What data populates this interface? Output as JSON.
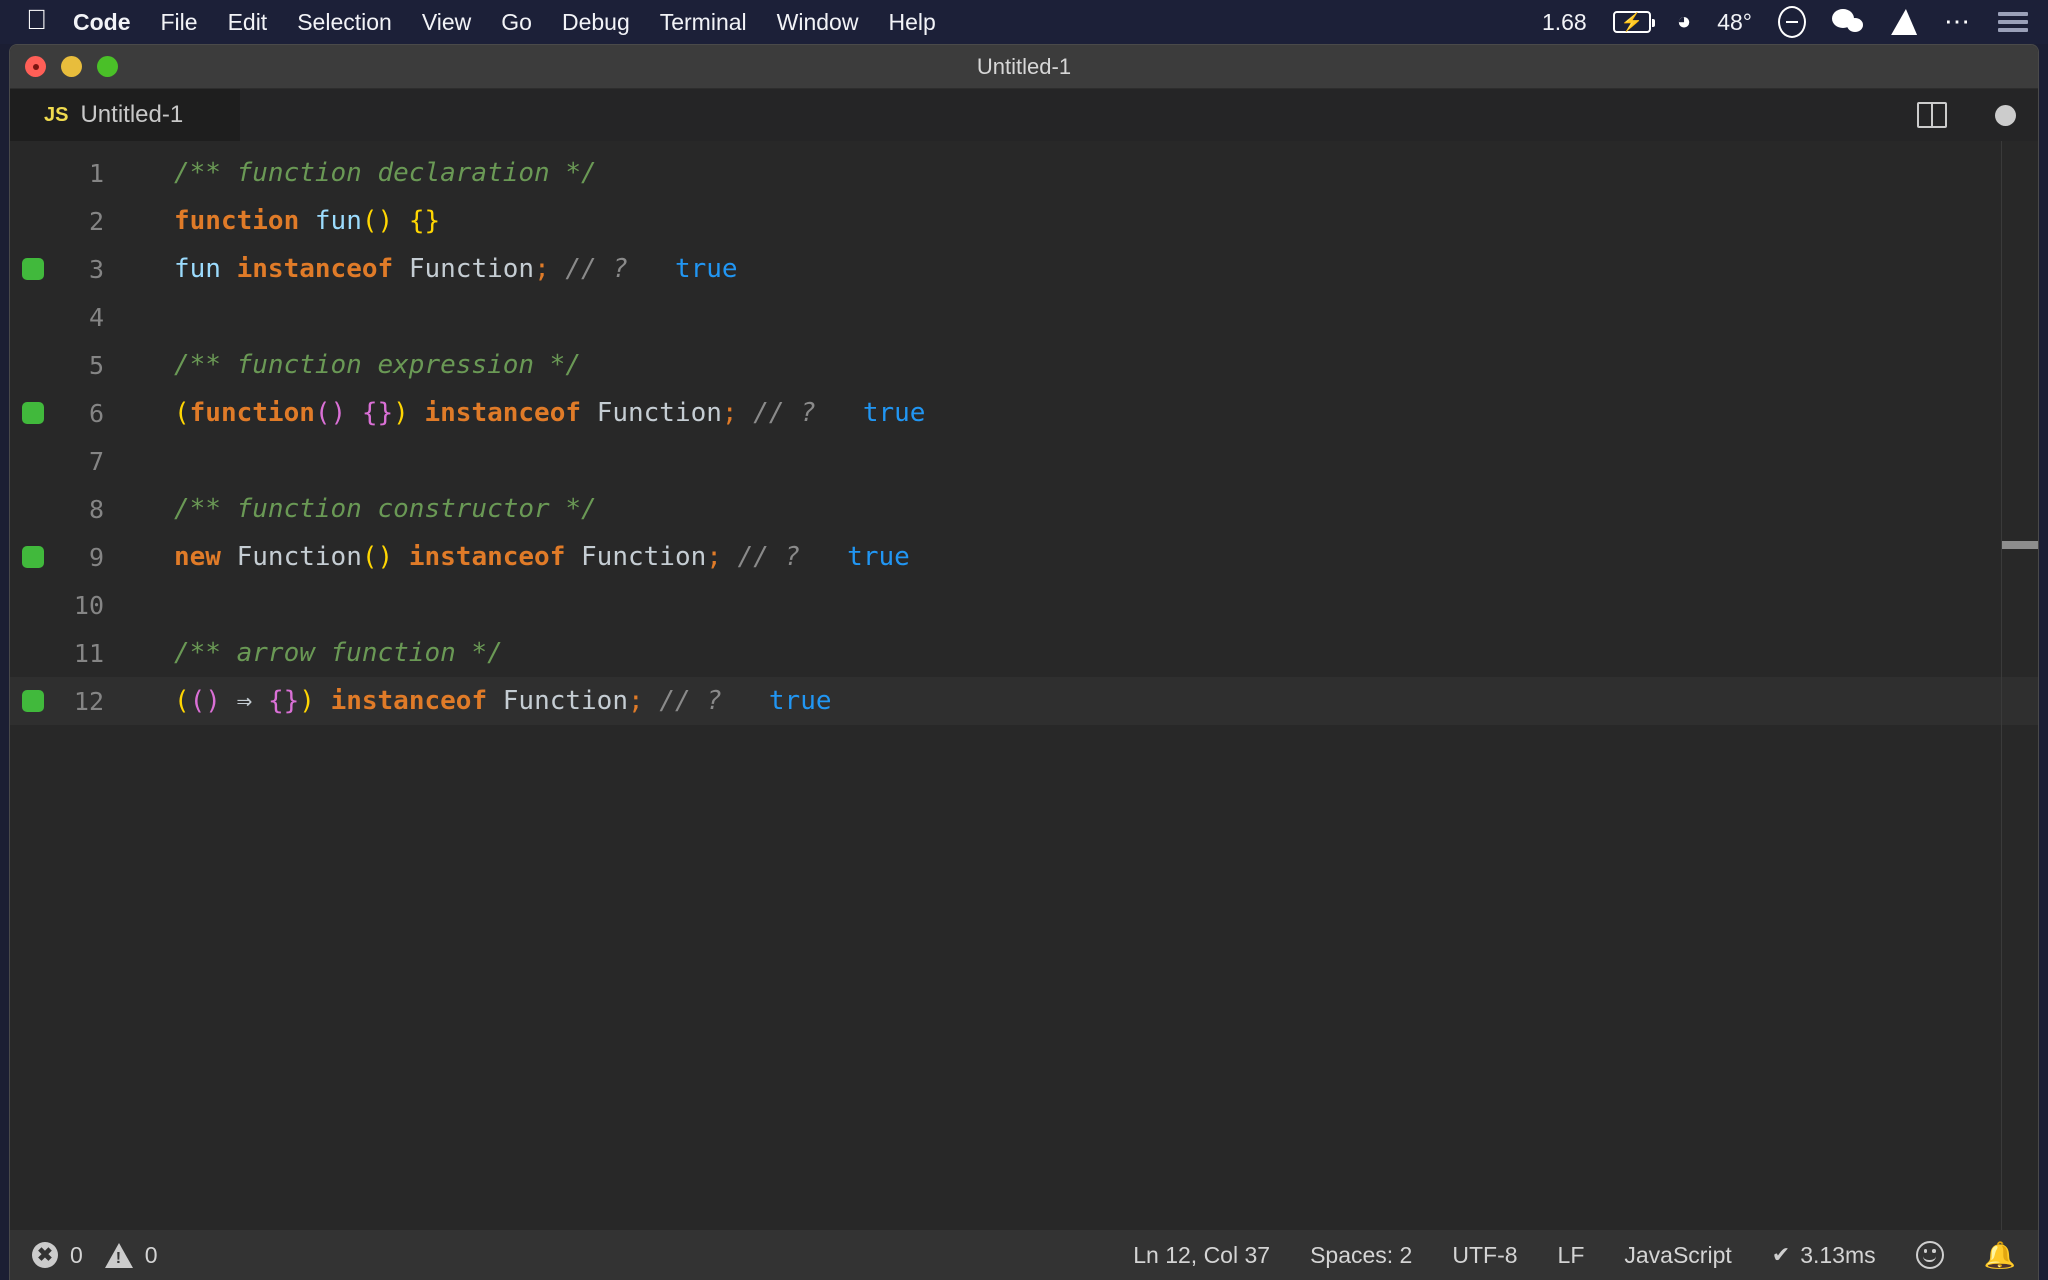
{
  "menubar": {
    "apple_logo": "apple-logo",
    "items": [
      "Code",
      "File",
      "Edit",
      "Selection",
      "View",
      "Go",
      "Debug",
      "Terminal",
      "Window",
      "Help"
    ],
    "right": {
      "load": "1.68",
      "battery_icon": "battery-charging-icon",
      "wifi_icon": "wifi-icon",
      "temperature": "48°",
      "dnd_icon": "do-not-disturb-icon",
      "wechat_icon": "wechat-icon",
      "diamond_icon": "diamond-icon",
      "ellipsis_icon": "ellipsis-icon",
      "list_icon": "control-center-list-icon"
    }
  },
  "window": {
    "title": "Untitled-1",
    "traffic_lights": [
      "close-button",
      "minimize-button",
      "maximize-button"
    ]
  },
  "tab": {
    "file_type": "JS",
    "label": "Untitled-1",
    "split_icon": "split-editor-icon",
    "dirty_icon": "unsaved-dot-icon"
  },
  "editor": {
    "language": "JavaScript",
    "lines": [
      {
        "no": "1",
        "marker": false,
        "active": false,
        "text": "/** function declaration */"
      },
      {
        "no": "2",
        "marker": false,
        "active": false,
        "text": "function fun() {}"
      },
      {
        "no": "3",
        "marker": true,
        "active": false,
        "text": "fun instanceof Function; // ?   true"
      },
      {
        "no": "4",
        "marker": false,
        "active": false,
        "text": ""
      },
      {
        "no": "5",
        "marker": false,
        "active": false,
        "text": "/** function expression */"
      },
      {
        "no": "6",
        "marker": true,
        "active": false,
        "text": "(function() {}) instanceof Function; // ?   true"
      },
      {
        "no": "7",
        "marker": false,
        "active": false,
        "text": ""
      },
      {
        "no": "8",
        "marker": false,
        "active": false,
        "text": "/** function constructor */"
      },
      {
        "no": "9",
        "marker": true,
        "active": false,
        "text": "new Function() instanceof Function; // ?   true"
      },
      {
        "no": "10",
        "marker": false,
        "active": false,
        "text": ""
      },
      {
        "no": "11",
        "marker": false,
        "active": false,
        "text": "/** arrow function */"
      },
      {
        "no": "12",
        "marker": true,
        "active": true,
        "text": "(() ⇒ {}) instanceof Function; // ?   true"
      }
    ],
    "tokens": {
      "line1": [
        {
          "t": "/** function declaration */",
          "c": "c-comment"
        }
      ],
      "line2": [
        {
          "t": "function",
          "c": "c-keyword"
        },
        {
          "t": " ",
          "c": "c-plain"
        },
        {
          "t": "fun",
          "c": "c-ident"
        },
        {
          "t": "()",
          "c": "c-yellow"
        },
        {
          "t": " ",
          "c": "c-plain"
        },
        {
          "t": "{}",
          "c": "c-yellow"
        }
      ],
      "line3": [
        {
          "t": "fun",
          "c": "c-ident"
        },
        {
          "t": " ",
          "c": "c-plain"
        },
        {
          "t": "instanceof",
          "c": "c-keyword"
        },
        {
          "t": " ",
          "c": "c-plain"
        },
        {
          "t": "Function",
          "c": "c-plain"
        },
        {
          "t": ";",
          "c": "c-punct"
        },
        {
          "t": " ",
          "c": "c-plain"
        },
        {
          "t": "// ?",
          "c": "c-linecomment"
        },
        {
          "t": "   ",
          "c": "c-plain"
        },
        {
          "t": "true",
          "c": "c-hint"
        }
      ],
      "line5": [
        {
          "t": "/** function expression */",
          "c": "c-comment"
        }
      ],
      "line6": [
        {
          "t": "(",
          "c": "c-yellow"
        },
        {
          "t": "function",
          "c": "c-keyword"
        },
        {
          "t": "()",
          "c": "c-magenta"
        },
        {
          "t": " ",
          "c": "c-plain"
        },
        {
          "t": "{}",
          "c": "c-magenta"
        },
        {
          "t": ")",
          "c": "c-yellow"
        },
        {
          "t": " ",
          "c": "c-plain"
        },
        {
          "t": "instanceof",
          "c": "c-keyword"
        },
        {
          "t": " ",
          "c": "c-plain"
        },
        {
          "t": "Function",
          "c": "c-plain"
        },
        {
          "t": ";",
          "c": "c-punct"
        },
        {
          "t": " ",
          "c": "c-plain"
        },
        {
          "t": "// ?",
          "c": "c-linecomment"
        },
        {
          "t": "   ",
          "c": "c-plain"
        },
        {
          "t": "true",
          "c": "c-hint"
        }
      ],
      "line8": [
        {
          "t": "/** function constructor */",
          "c": "c-comment"
        }
      ],
      "line9": [
        {
          "t": "new",
          "c": "c-keyword"
        },
        {
          "t": " ",
          "c": "c-plain"
        },
        {
          "t": "Function",
          "c": "c-plain"
        },
        {
          "t": "()",
          "c": "c-yellow"
        },
        {
          "t": " ",
          "c": "c-plain"
        },
        {
          "t": "instanceof",
          "c": "c-keyword"
        },
        {
          "t": " ",
          "c": "c-plain"
        },
        {
          "t": "Function",
          "c": "c-plain"
        },
        {
          "t": ";",
          "c": "c-punct"
        },
        {
          "t": " ",
          "c": "c-plain"
        },
        {
          "t": "// ?",
          "c": "c-linecomment"
        },
        {
          "t": "   ",
          "c": "c-plain"
        },
        {
          "t": "true",
          "c": "c-hint"
        }
      ],
      "line11": [
        {
          "t": "/** arrow function */",
          "c": "c-comment"
        }
      ],
      "line12": [
        {
          "t": "(",
          "c": "c-yellow"
        },
        {
          "t": "()",
          "c": "c-magenta"
        },
        {
          "t": " ",
          "c": "c-plain"
        },
        {
          "t": "⇒",
          "c": "c-arrow"
        },
        {
          "t": " ",
          "c": "c-plain"
        },
        {
          "t": "{}",
          "c": "c-magenta"
        },
        {
          "t": ")",
          "c": "c-yellow"
        },
        {
          "t": " ",
          "c": "c-plain"
        },
        {
          "t": "instanceof",
          "c": "c-keyword"
        },
        {
          "t": " ",
          "c": "c-plain"
        },
        {
          "t": "Function",
          "c": "c-plain"
        },
        {
          "t": ";",
          "c": "c-punct"
        },
        {
          "t": " ",
          "c": "c-plain"
        },
        {
          "t": "// ?",
          "c": "c-linecomment"
        },
        {
          "t": "   ",
          "c": "c-plain"
        },
        {
          "t": "true",
          "c": "c-hint"
        }
      ]
    }
  },
  "statusbar": {
    "error_icon": "error-icon",
    "error_count": "0",
    "warning_icon": "warning-icon",
    "warning_count": "0",
    "cursor_position": "Ln 12, Col 37",
    "indentation": "Spaces: 2",
    "encoding": "UTF-8",
    "eol": "LF",
    "language": "JavaScript",
    "run_check": "✔",
    "run_time": "3.13ms",
    "feedback_icon": "smiley-icon",
    "notifications_icon": "bell-icon"
  },
  "colors": {
    "menubar_bg": "#1c2038",
    "titlebar_bg": "#3c3c3c",
    "tabbar_bg": "#252526",
    "editor_bg": "#282828",
    "statusbar_bg": "#333333",
    "accent_keyword": "#e07b28",
    "accent_comment": "#6a9955",
    "accent_hint": "#2196f3",
    "marker_green": "#41b93c",
    "js_yellow": "#f0db4f"
  }
}
